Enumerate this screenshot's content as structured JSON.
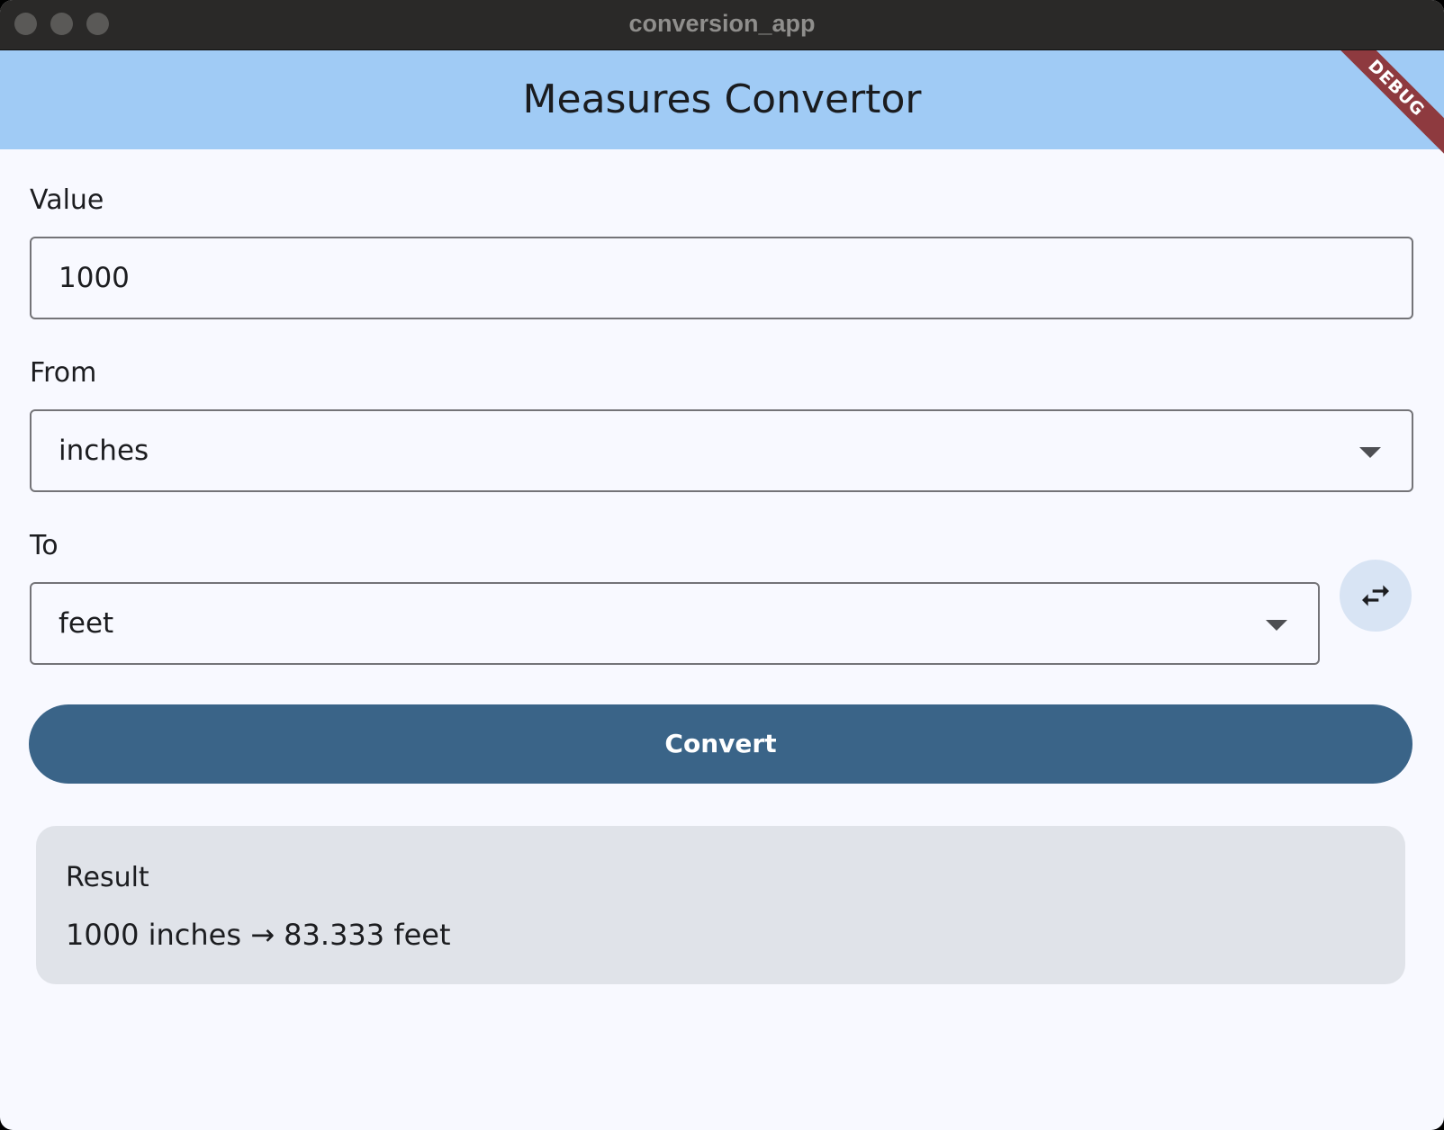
{
  "window": {
    "title": "conversion_app"
  },
  "appbar": {
    "title": "Measures Convertor",
    "debug_label": "DEBUG"
  },
  "form": {
    "value_label": "Value",
    "value": "1000",
    "from_label": "From",
    "from_selected": "inches",
    "to_label": "To",
    "to_selected": "feet",
    "convert_label": "Convert"
  },
  "result": {
    "title": "Result",
    "text": "1000 inches → 83.333 feet"
  },
  "icons": {
    "swap": "swap-horiz-icon",
    "dropdown": "arrow-drop-down-icon"
  },
  "colors": {
    "appbar": "#a0cbf5",
    "primary": "#3a6488",
    "swap_bg": "#d8e4f4",
    "result_bg": "#e0e3e9",
    "debug": "#8e3a3f",
    "background": "#f8f9ff"
  }
}
